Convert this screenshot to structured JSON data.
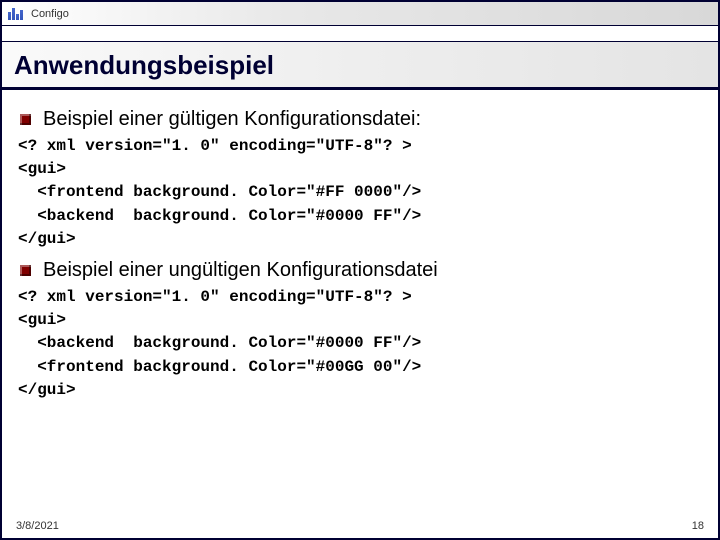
{
  "header": {
    "app_name": "Configo"
  },
  "title": "Anwendungsbeispiel",
  "bullets": {
    "b1": "Beispiel einer gültigen Konfigurationsdatei:",
    "b2": "Beispiel einer ungültigen Konfigurationsdatei"
  },
  "code1": {
    "l1": "<? xml version=\"1. 0\" encoding=\"UTF-8\"? >",
    "l2": "<gui>",
    "l3": "  <frontend background. Color=\"#FF 0000\"/>",
    "l4": "  <backend  background. Color=\"#0000 FF\"/>",
    "l5": "</gui>"
  },
  "code2": {
    "l1": "<? xml version=\"1. 0\" encoding=\"UTF-8\"? >",
    "l2": "<gui>",
    "l3": "  <backend  background. Color=\"#0000 FF\"/>",
    "l4": "  <frontend background. Color=\"#00GG 00\"/>",
    "l5": "</gui>"
  },
  "footer": {
    "date": "3/8/2021",
    "page": "18"
  }
}
